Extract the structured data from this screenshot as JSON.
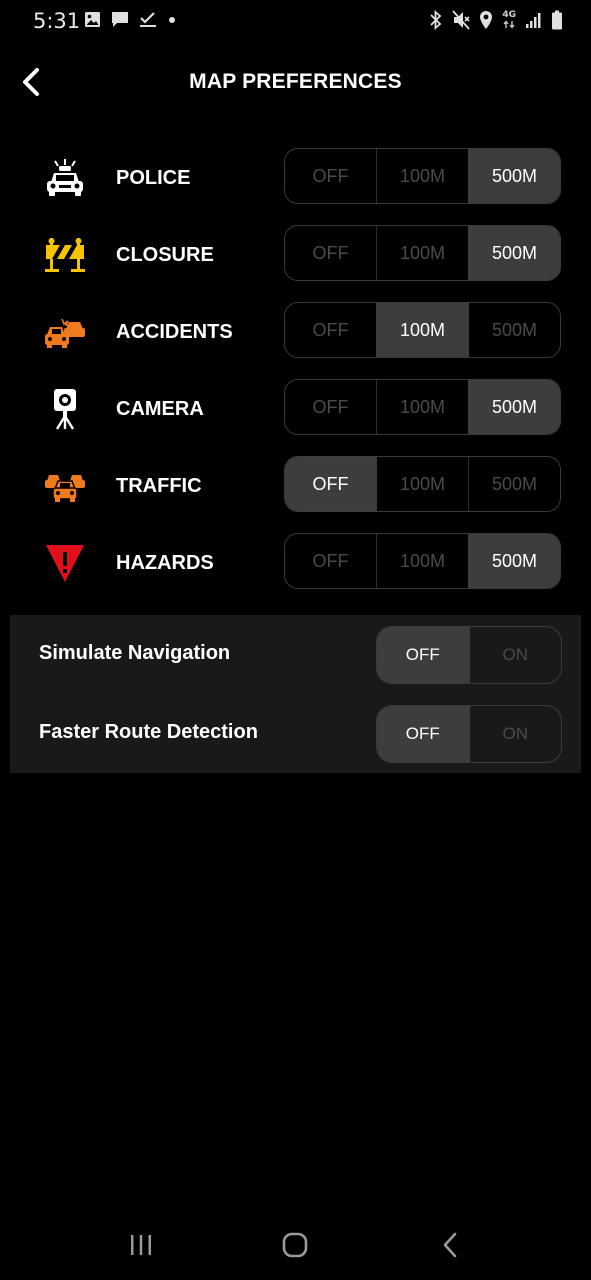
{
  "status_bar": {
    "time": "5:31",
    "network": "4G",
    "icons_left": [
      "image-icon",
      "message-icon",
      "check-icon",
      "dot-icon"
    ],
    "icons_right": [
      "bluetooth-icon",
      "vibrate-mute-icon",
      "location-icon",
      "network-icon",
      "signal-icon",
      "battery-icon"
    ]
  },
  "header": {
    "title": "MAP PREFERENCES",
    "back_icon": "chevron-left-icon"
  },
  "alerts": [
    {
      "id": "police",
      "label": "POLICE",
      "icon": "police-car-icon",
      "options": [
        "OFF",
        "100M",
        "500M"
      ],
      "selected": "500M"
    },
    {
      "id": "closure",
      "label": "CLOSURE",
      "icon": "road-closure-icon",
      "options": [
        "OFF",
        "100M",
        "500M"
      ],
      "selected": "500M"
    },
    {
      "id": "accidents",
      "label": "ACCIDENTS",
      "icon": "car-crash-icon",
      "options": [
        "OFF",
        "100M",
        "500M"
      ],
      "selected": "100M"
    },
    {
      "id": "camera",
      "label": "CAMERA",
      "icon": "speed-camera-icon",
      "options": [
        "OFF",
        "100M",
        "500M"
      ],
      "selected": "500M"
    },
    {
      "id": "traffic",
      "label": "TRAFFIC",
      "icon": "traffic-jam-icon",
      "options": [
        "OFF",
        "100M",
        "500M"
      ],
      "selected": "OFF"
    },
    {
      "id": "hazards",
      "label": "HAZARDS",
      "icon": "hazard-triangle-icon",
      "options": [
        "OFF",
        "100M",
        "500M"
      ],
      "selected": "500M"
    }
  ],
  "toggles": [
    {
      "id": "simulate-navigation",
      "label": "Simulate Navigation",
      "options": [
        "OFF",
        "ON"
      ],
      "selected": "OFF"
    },
    {
      "id": "faster-route-detection",
      "label": "Faster Route Detection",
      "options": [
        "OFF",
        "ON"
      ],
      "selected": "OFF"
    }
  ],
  "nav_bar": {
    "icons": [
      "recent-apps-icon",
      "home-icon",
      "back-icon"
    ]
  },
  "colors": {
    "background": "#000000",
    "panel": "#191919",
    "segment_active": "#3d3d3d",
    "segment_inactive_text": "#4a4a4a",
    "police": "#ffffff",
    "closure": "#f5c400",
    "accidents": "#f07a1e",
    "traffic": "#f07a1e",
    "hazards": "#e0101a"
  }
}
